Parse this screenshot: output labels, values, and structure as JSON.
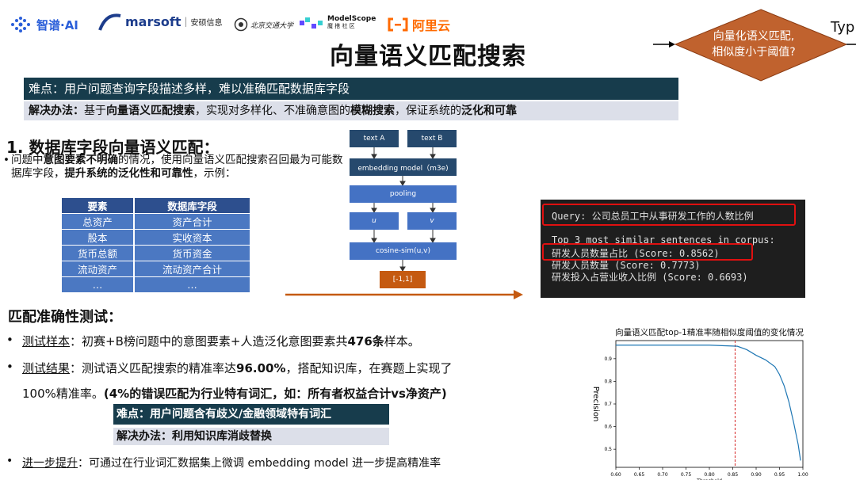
{
  "header": {
    "logo1": "智谱·AI",
    "logo2": "marsoft",
    "logo2_sub": "安硕信息",
    "logo3": "北京交通大学",
    "logo4": "ModelScope",
    "logo4_sub": "魔 搭 社 区",
    "logo5": "阿里云",
    "title": "向量语义匹配搜索"
  },
  "flow": {
    "diamond_line1": "向量化语义匹配,",
    "diamond_line2": "相似度小于阈值?",
    "side_text": "Typ"
  },
  "banner_difficulty": "难点：用户问题查询字段描述多样，难以准确匹配数据库字段",
  "banner_solution": {
    "prefix": "解决办法：",
    "t1": "基于",
    "b1": "向量语义匹配搜索",
    "t2": "，实现对多样化、不准确意图的",
    "b2": "模糊搜索",
    "t3": "，保证系统的",
    "b3": "泛化和可靠"
  },
  "section1": {
    "heading": "1. 数据库字段向量语义匹配：",
    "p1": "问题中",
    "p1b": "意图要素不明确",
    "p2": "的情况，使用向量语义匹配搜索召回最为可能数据库字段，",
    "p2b": "提升系统的泛化性和可靠性",
    "p3": "，示例："
  },
  "table": {
    "headers": [
      "要素",
      "数据库字段"
    ],
    "rows": [
      [
        "总资产",
        "资产合计"
      ],
      [
        "股本",
        "实收资本"
      ],
      [
        "货币总额",
        "货币资金"
      ],
      [
        "流动资产",
        "流动资产合计"
      ],
      [
        "…",
        "…"
      ]
    ]
  },
  "diagram": {
    "text_a": "text A",
    "text_b": "text B",
    "embedding": "embedding model（m3e)",
    "pooling": "pooling",
    "u": "u",
    "v": "v",
    "cosine": "cosine-sim(u,v)",
    "range": "[-1,1]"
  },
  "terminal": {
    "query": "Query: 公司总员工中从事研发工作的人数比例",
    "top": "Top 3 most similar sentences in corpus:",
    "r1": "研发人员数量占比 (Score: 0.8562)",
    "r2": "研发人员数量 (Score: 0.7773)",
    "r3": "研发投入占营业收入比例 (Score: 0.6693)"
  },
  "section2": {
    "heading": "匹配准确性测试：",
    "b1_label": "测试样本",
    "b1_text": "：初赛+B榜问题中的意图要素+人造泛化意图要素共",
    "b1_bold": "476条",
    "b1_end": "样本。",
    "b2_label": "测试结果",
    "b2_text": "：测试语义匹配搜索的精准率达",
    "b2_bold": "96.00%",
    "b2_end": "，搭配知识库，在赛题上实现了",
    "b2_line2": "100%精准率。",
    "b2_line2b": "(4%的错误匹配为行业特有词汇，如：所有者权益合计vs净资产)",
    "c_diff_prefix": "难点：用户问题含有",
    "c_diff_bold": "歧义/金融领域特有词汇",
    "c_sol": "解决办法：利用知识库消歧替换",
    "b3_label": "进一步提升",
    "b3_text": "：可通过在行业词汇数据集上微调 embedding model 进一步提高精准率"
  },
  "chart_data": {
    "type": "line",
    "title": "向量语义匹配top-1精准率随相似度阈值的变化情况",
    "xlabel": "Threshold",
    "ylabel": "Precision",
    "xlim": [
      0.6,
      1.0
    ],
    "ylim": [
      0.42,
      0.98
    ],
    "xticks": [
      "0.60",
      "0.65",
      "0.70",
      "0.75",
      "0.80",
      "0.85",
      "0.90",
      "0.95",
      "1.00"
    ],
    "yticks": [
      "0.5",
      "0.6",
      "0.7",
      "0.8",
      "0.9"
    ],
    "x": [
      0.6,
      0.7,
      0.8,
      0.86,
      0.88,
      0.9,
      0.92,
      0.94,
      0.95,
      0.96,
      0.97,
      0.98,
      0.99,
      0.995
    ],
    "y": [
      0.96,
      0.96,
      0.96,
      0.955,
      0.94,
      0.915,
      0.895,
      0.865,
      0.83,
      0.78,
      0.71,
      0.62,
      0.52,
      0.45
    ],
    "vline": 0.855,
    "color": "#1f77b4",
    "vline_color": "#d62728"
  },
  "colors": {
    "arrow": "#c55a11",
    "diamond": "#c0622e",
    "dark_banner": "#173c4c",
    "table_header": "#2d4f8e",
    "table_cell": "#4b78c2"
  }
}
